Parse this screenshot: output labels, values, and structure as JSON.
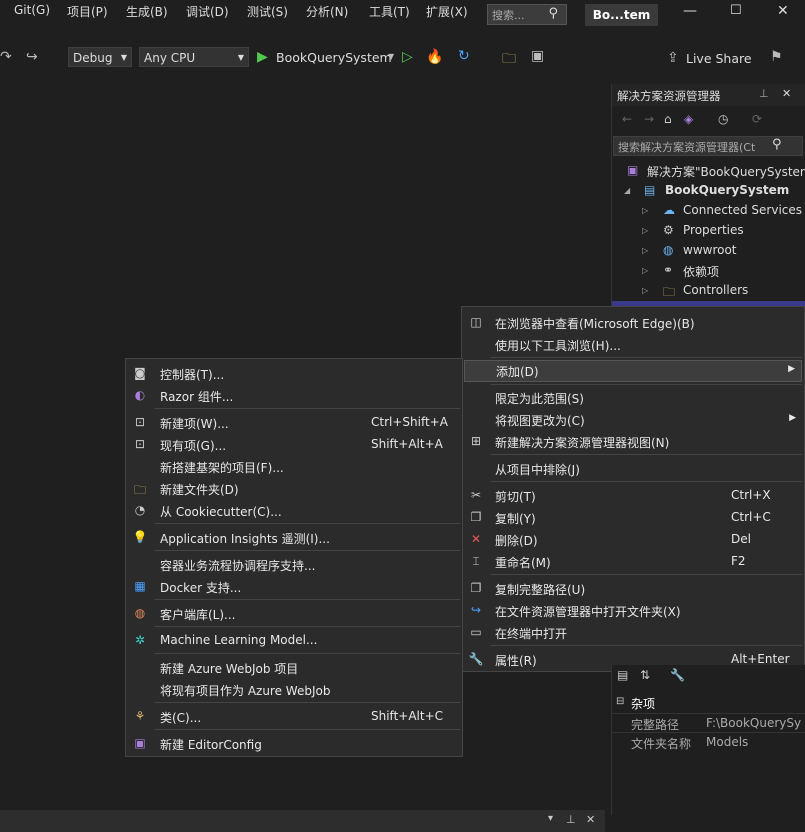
{
  "menubar": {
    "items": [
      "Git(G)",
      "项目(P)",
      "生成(B)",
      "调试(D)",
      "测试(S)",
      "分析(N)",
      "工具(T)",
      "扩展(X)"
    ],
    "search_placeholder": "搜索...",
    "title": "Bo...tem"
  },
  "toolbar": {
    "config": "Debug",
    "platform": "Any CPU",
    "run_target": "BookQuerySystem",
    "live_share": "Live Share"
  },
  "solution_explorer": {
    "title": "解决方案资源管理器",
    "search_placeholder": "搜索解决方案资源管理器(Ct",
    "items": [
      {
        "label": "解决方案\"BookQuerySystem\""
      },
      {
        "label": "BookQuerySystem"
      },
      {
        "label": "Connected Services"
      },
      {
        "label": "Properties"
      },
      {
        "label": "wwwroot"
      },
      {
        "label": "依赖项"
      },
      {
        "label": "Controllers"
      }
    ]
  },
  "context_menu": {
    "items": [
      {
        "label": "在浏览器中查看(Microsoft Edge)(B)",
        "shortcut": ""
      },
      {
        "label": "使用以下工具浏览(H)...",
        "shortcut": ""
      },
      {
        "label": "添加(D)",
        "shortcut": ""
      },
      {
        "label": "限定为此范围(S)",
        "shortcut": ""
      },
      {
        "label": "将视图更改为(C)",
        "shortcut": ""
      },
      {
        "label": "新建解决方案资源管理器视图(N)",
        "shortcut": ""
      },
      {
        "label": "从项目中排除(J)",
        "shortcut": ""
      },
      {
        "label": "剪切(T)",
        "shortcut": "Ctrl+X"
      },
      {
        "label": "复制(Y)",
        "shortcut": "Ctrl+C"
      },
      {
        "label": "删除(D)",
        "shortcut": "Del"
      },
      {
        "label": "重命名(M)",
        "shortcut": "F2"
      },
      {
        "label": "复制完整路径(U)",
        "shortcut": ""
      },
      {
        "label": "在文件资源管理器中打开文件夹(X)",
        "shortcut": ""
      },
      {
        "label": "在终端中打开",
        "shortcut": ""
      },
      {
        "label": "属性(R)",
        "shortcut": "Alt+Enter"
      }
    ]
  },
  "add_submenu": {
    "items": [
      {
        "label": "控制器(T)...",
        "shortcut": ""
      },
      {
        "label": "Razor 组件...",
        "shortcut": ""
      },
      {
        "label": "新建项(W)...",
        "shortcut": "Ctrl+Shift+A"
      },
      {
        "label": "现有项(G)...",
        "shortcut": "Shift+Alt+A"
      },
      {
        "label": "新搭建基架的项目(F)...",
        "shortcut": ""
      },
      {
        "label": "新建文件夹(D)",
        "shortcut": ""
      },
      {
        "label": "从 Cookiecutter(C)...",
        "shortcut": ""
      },
      {
        "label": "Application Insights 遥测(I)...",
        "shortcut": ""
      },
      {
        "label": "容器业务流程协调程序支持...",
        "shortcut": ""
      },
      {
        "label": "Docker 支持...",
        "shortcut": ""
      },
      {
        "label": "客户端库(L)...",
        "shortcut": ""
      },
      {
        "label": "Machine Learning Model...",
        "shortcut": ""
      },
      {
        "label": "新建 Azure WebJob 项目",
        "shortcut": ""
      },
      {
        "label": "将现有项目作为 Azure WebJob",
        "shortcut": ""
      },
      {
        "label": "类(C)...",
        "shortcut": "Shift+Alt+C"
      },
      {
        "label": "新建 EditorConfig",
        "shortcut": ""
      }
    ]
  },
  "properties": {
    "section": "杂项",
    "rows": [
      {
        "name": "完整路径",
        "value": "F:\\BookQuerySy"
      },
      {
        "name": "文件夹名称",
        "value": "Models"
      }
    ]
  }
}
